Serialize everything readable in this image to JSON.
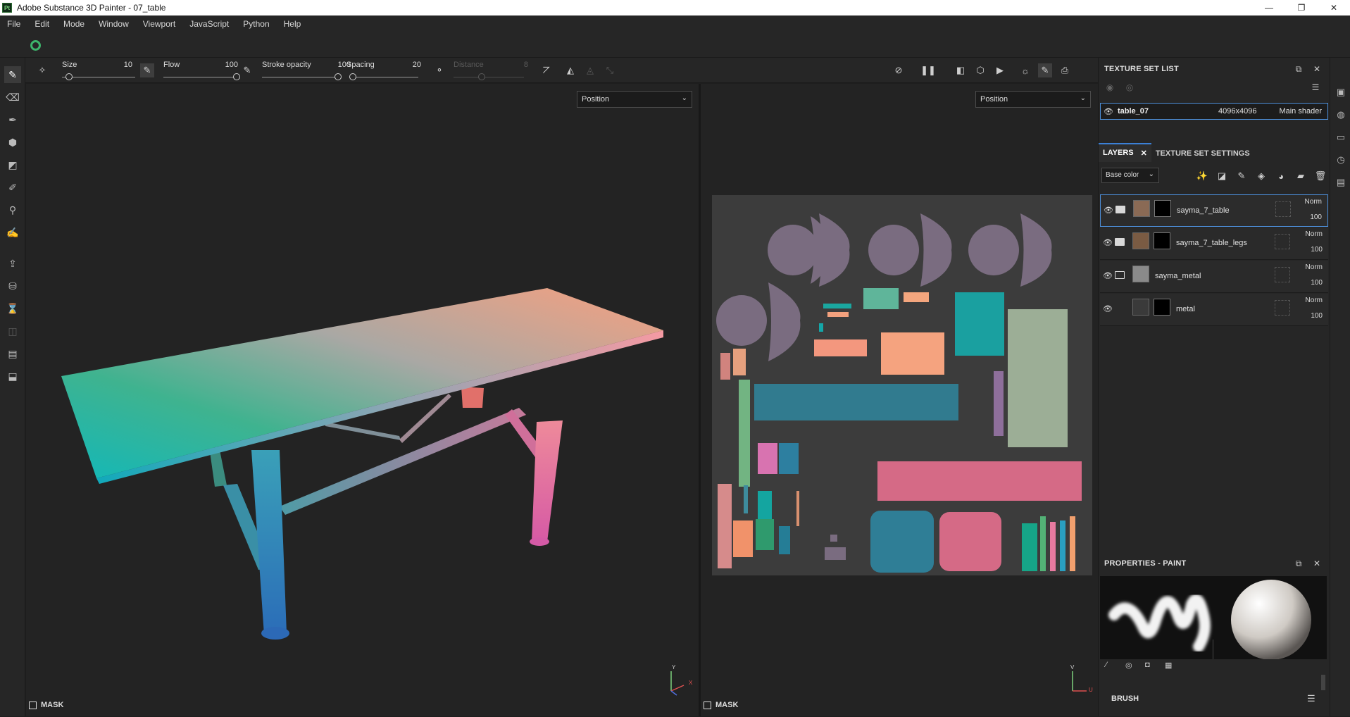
{
  "window": {
    "app_icon": "Pt",
    "title": "Adobe Substance 3D Painter - 07_table",
    "minimize": "—",
    "restore": "❐",
    "close": "✕"
  },
  "menu": [
    "File",
    "Edit",
    "Mode",
    "Window",
    "Viewport",
    "JavaScript",
    "Python",
    "Help"
  ],
  "context_bar": {
    "size_label": "Size",
    "size_value": "10",
    "size_fraction": 0.1,
    "flow_label": "Flow",
    "flow_value": "100",
    "flow_fraction": 1.0,
    "stroke_opacity_label": "Stroke opacity",
    "stroke_opacity_value": "100",
    "stroke_opacity_fraction": 1.0,
    "spacing_label": "Spacing",
    "spacing_value": "20",
    "spacing_fraction": 0.05,
    "distance_label": "Distance",
    "distance_value": "8",
    "distance_fraction": 0.4
  },
  "viewports": {
    "left_dropdown": "Position",
    "right_dropdown": "Position",
    "left_mask_label": "MASK",
    "right_mask_label": "MASK",
    "axis_x": "X",
    "axis_y": "Y",
    "axis_u": "U",
    "axis_v": "V"
  },
  "texture_set_list": {
    "title": "TEXTURE SET LIST",
    "rows": [
      {
        "name": "table_07",
        "resolution": "4096x4096",
        "shader": "Main shader"
      }
    ]
  },
  "layers_panel": {
    "tab_layers": "LAYERS",
    "tab_close": "✕",
    "tab_texture_settings": "TEXTURE SET SETTINGS",
    "channel": "Base color",
    "layers": [
      {
        "name": "sayma_7_table",
        "blend": "Norm",
        "opacity": "100",
        "thumb_color": "#8a6a55"
      },
      {
        "name": "sayma_7_table_legs",
        "blend": "Norm",
        "opacity": "100",
        "thumb_color": "#7a5b43"
      },
      {
        "name": "sayma_metal",
        "blend": "Norm",
        "opacity": "100",
        "thumb_color": "#8a8a8a"
      },
      {
        "name": "metal",
        "blend": "Norm",
        "opacity": "100",
        "thumb_color": "#3a3a3a"
      }
    ]
  },
  "properties": {
    "title": "PROPERTIES - PAINT",
    "brush_label": "BRUSH"
  },
  "colors": {
    "accent": "#3b80d6",
    "panel_bg": "#262626",
    "viewport_bg": "#232323"
  }
}
